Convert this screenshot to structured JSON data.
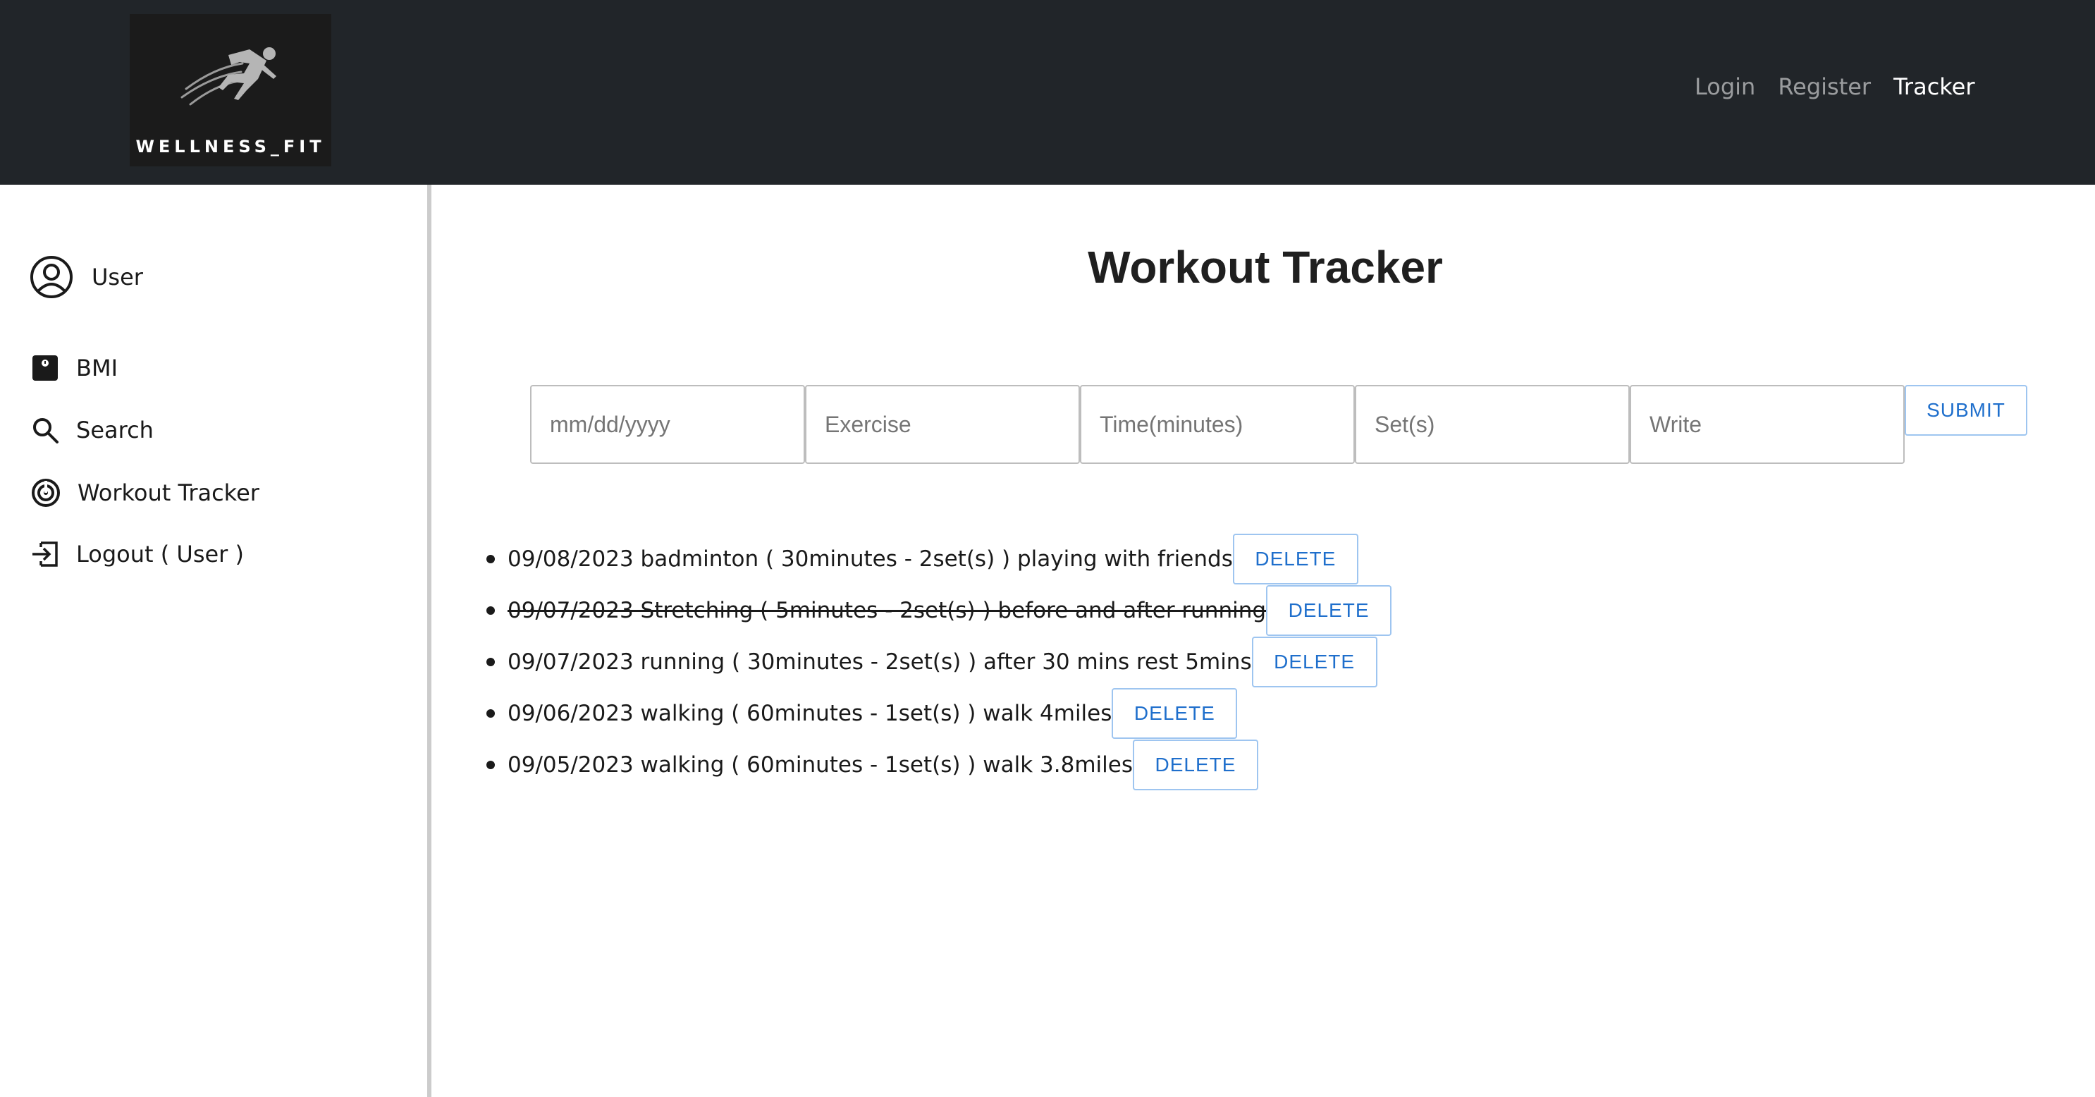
{
  "brand": {
    "name": "WELLNESS_FIT"
  },
  "nav": {
    "links": [
      {
        "label": "Login",
        "active": false
      },
      {
        "label": "Register",
        "active": false
      },
      {
        "label": "Tracker",
        "active": true
      }
    ]
  },
  "sidebar": {
    "user": {
      "name": "User",
      "icon": "user-circle-icon"
    },
    "items": [
      {
        "label": "BMI",
        "icon": "scale-icon"
      },
      {
        "label": "Search",
        "icon": "search-icon"
      },
      {
        "label": "Workout Tracker",
        "icon": "target-icon"
      },
      {
        "label": "Logout ( User )",
        "icon": "logout-icon"
      }
    ]
  },
  "main": {
    "title": "Workout Tracker",
    "form": {
      "date_placeholder": "mm/dd/yyyy",
      "exercise_placeholder": "Exercise",
      "time_placeholder": "Time(minutes)",
      "sets_placeholder": "Set(s)",
      "note_placeholder": "Write",
      "submit_label": "SUBMIT"
    },
    "delete_label": "DELETE",
    "entries": [
      {
        "text": "09/08/2023 badminton ( 30minutes - 2set(s) ) playing with friends",
        "done": false
      },
      {
        "text": "09/07/2023 Stretching ( 5minutes - 2set(s) ) before and after running",
        "done": true
      },
      {
        "text": "09/07/2023 running ( 30minutes - 2set(s) ) after 30 mins rest 5mins",
        "done": false
      },
      {
        "text": "09/06/2023 walking ( 60minutes - 1set(s) ) walk 4miles",
        "done": false
      },
      {
        "text": "09/05/2023 walking ( 60minutes - 1set(s) ) walk 3.8miles",
        "done": false
      }
    ]
  },
  "colors": {
    "navbar_bg": "#212529",
    "accent_blue": "#1f6fcc",
    "sidebar_border": "#cccccc"
  }
}
